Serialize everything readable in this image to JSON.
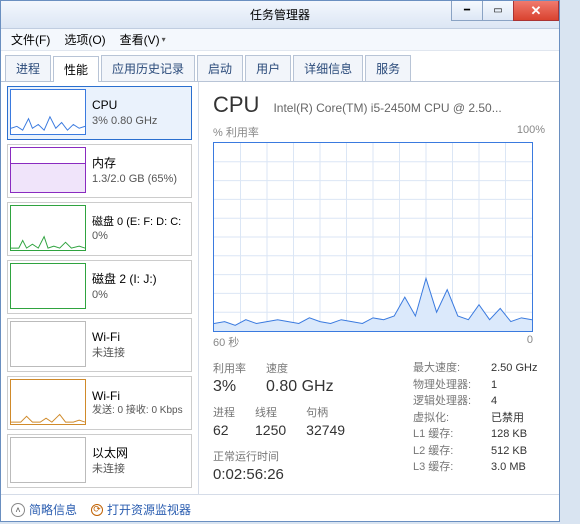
{
  "window": {
    "title": "任务管理器"
  },
  "menus": {
    "file": "文件(F)",
    "options": "选项(O)",
    "view": "查看(V)"
  },
  "tabs": [
    "进程",
    "性能",
    "应用历史记录",
    "启动",
    "用户",
    "详细信息",
    "服务"
  ],
  "active_tab": 1,
  "sidebar": {
    "items": [
      {
        "title": "CPU",
        "sub": "3% 0.80 GHz"
      },
      {
        "title": "内存",
        "sub": "1.3/2.0 GB (65%)"
      },
      {
        "title": "磁盘 0 (E: F: D: C:",
        "sub": "0%"
      },
      {
        "title": "磁盘 2 (I: J:)",
        "sub": "0%"
      },
      {
        "title": "Wi-Fi",
        "sub": "未连接"
      },
      {
        "title": "Wi-Fi",
        "sub": "发送: 0 接收: 0 Kbps"
      },
      {
        "title": "以太网",
        "sub": "未连接"
      }
    ]
  },
  "main": {
    "heading": "CPU",
    "model": "Intel(R) Core(TM) i5-2450M CPU @ 2.50...",
    "chart": {
      "ylabel": "% 利用率",
      "ymax": "100%",
      "x_left": "60 秒",
      "x_right": "0"
    },
    "stats1": {
      "util_label": "利用率",
      "util_val": "3%",
      "speed_label": "速度",
      "speed_val": "0.80 GHz"
    },
    "stats2": {
      "proc_label": "进程",
      "proc_val": "62",
      "threads_label": "线程",
      "threads_val": "1250",
      "handles_label": "句柄",
      "handles_val": "32749"
    },
    "uptime": {
      "label": "正常运行时间",
      "val": "0:02:56:26"
    },
    "specs": {
      "maxspeed_k": "最大速度:",
      "maxspeed_v": "2.50 GHz",
      "sockets_k": "物理处理器:",
      "sockets_v": "1",
      "logical_k": "逻辑处理器:",
      "logical_v": "4",
      "virt_k": "虚拟化:",
      "virt_v": "已禁用",
      "l1_k": "L1 缓存:",
      "l1_v": "128 KB",
      "l2_k": "L2 缓存:",
      "l2_v": "512 KB",
      "l3_k": "L3 缓存:",
      "l3_v": "3.0 MB"
    }
  },
  "footer": {
    "brief": "简略信息",
    "resmon": "打开资源监视器"
  },
  "chart_data": {
    "type": "line",
    "title": "% 利用率",
    "xlabel": "60 秒",
    "ylabel": "% 利用率",
    "ylim": [
      0,
      100
    ],
    "x": [
      60,
      58,
      56,
      54,
      52,
      50,
      48,
      46,
      44,
      42,
      40,
      38,
      36,
      34,
      32,
      30,
      28,
      26,
      24,
      22,
      20,
      18,
      16,
      14,
      12,
      10,
      8,
      6,
      4,
      2,
      0
    ],
    "values": [
      4,
      5,
      3,
      6,
      4,
      5,
      6,
      5,
      4,
      7,
      5,
      4,
      6,
      5,
      4,
      7,
      6,
      8,
      18,
      8,
      28,
      10,
      22,
      8,
      6,
      14,
      6,
      12,
      5,
      7,
      6
    ]
  },
  "colors": {
    "cpu": "#3a7adf",
    "mem": "#8a2bc0",
    "disk": "#2fa33f",
    "wifi1": "#999",
    "wifi2": "#d08a2a",
    "eth": "#999"
  }
}
